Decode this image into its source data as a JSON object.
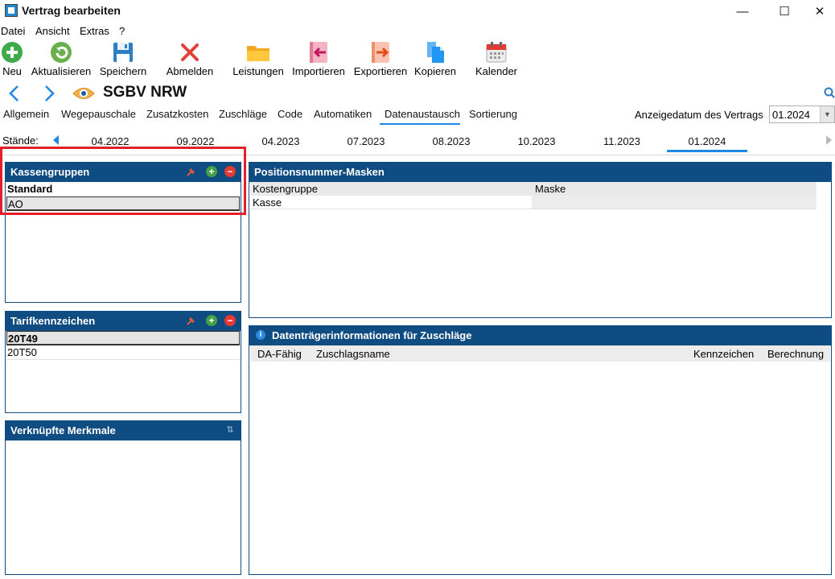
{
  "window": {
    "title": "Vertrag bearbeiten",
    "minimize": "—",
    "maximize": "☐",
    "close": "✕"
  },
  "menu": [
    "Datei",
    "Ansicht",
    "Extras",
    "?"
  ],
  "toolbar": {
    "neu": "Neu",
    "aktualisieren": "Aktualisieren",
    "speichern": "Speichern",
    "abmelden": "Abmelden",
    "leistungen": "Leistungen",
    "importieren": "Importieren",
    "exportieren": "Exportieren",
    "kopieren": "Kopieren",
    "kalender": "Kalender"
  },
  "contract": {
    "name": "SGBV NRW"
  },
  "tabs": [
    "Allgemein",
    "Wegepauschale",
    "Zusatzkosten",
    "Zuschläge",
    "Code",
    "Automatiken",
    "Datenaustausch",
    "Sortierung"
  ],
  "active_tab": "Datenaustausch",
  "display_date": {
    "label": "Anzeigedatum des Vertrags",
    "value": "01.2024"
  },
  "staende": {
    "label": "Stände:",
    "items": [
      "04.2022",
      "09.2022",
      "04.2023",
      "07.2023",
      "08.2023",
      "10.2023",
      "11.2023",
      "01.2024"
    ],
    "active": "01.2024"
  },
  "kassengruppen": {
    "title": "Kassengruppen",
    "rows": [
      "Standard",
      "AO"
    ]
  },
  "tarifkennzeichen": {
    "title": "Tarifkennzeichen",
    "rows": [
      "20T49",
      "20T50"
    ]
  },
  "merkmale": {
    "title": "Verknüpfte Merkmale"
  },
  "masken": {
    "title": "Positionsnummer-Masken",
    "columns": [
      "Kostengruppe",
      "Maske"
    ],
    "rows": [
      {
        "kostengruppe": "Kasse",
        "maske": ""
      }
    ]
  },
  "datentraeger": {
    "title": "Datenträgerinformationen für Zuschläge",
    "columns": [
      "DA-Fähig",
      "Zuschlagsname",
      "Kennzeichen",
      "Berechnung"
    ]
  },
  "colors": {
    "panel_header": "#0f4c81",
    "accent": "#1e88e5",
    "highlight": "#e3202a"
  }
}
